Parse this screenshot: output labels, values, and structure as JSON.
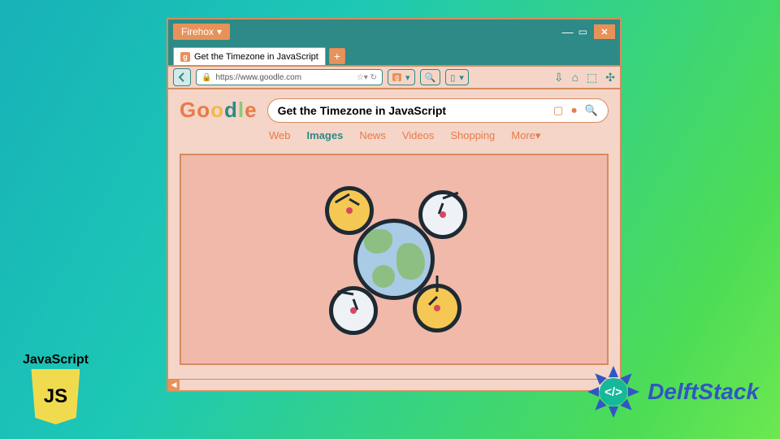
{
  "browser": {
    "name": "Firehox",
    "tab_title": "Get the Timezone in JavaScript",
    "url": "https://www.goodle.com",
    "newtab_label": "+",
    "close_glyph": "✕"
  },
  "search": {
    "logo_chars": {
      "g": "G",
      "o1": "o",
      "o2": "o",
      "d": "d",
      "l": "l",
      "e": "e"
    },
    "query": "Get the Timezone in JavaScript",
    "icons": {
      "camera": "camera-icon",
      "mic": "mic-icon",
      "search": "search-icon"
    }
  },
  "categories": [
    "Web",
    "Images",
    "News",
    "Videos",
    "Shopping",
    "More▾"
  ],
  "active_category_index": 1,
  "badges": {
    "js_label": "JavaScript",
    "js_shield": "JS",
    "delftstack": "DelftStack"
  }
}
